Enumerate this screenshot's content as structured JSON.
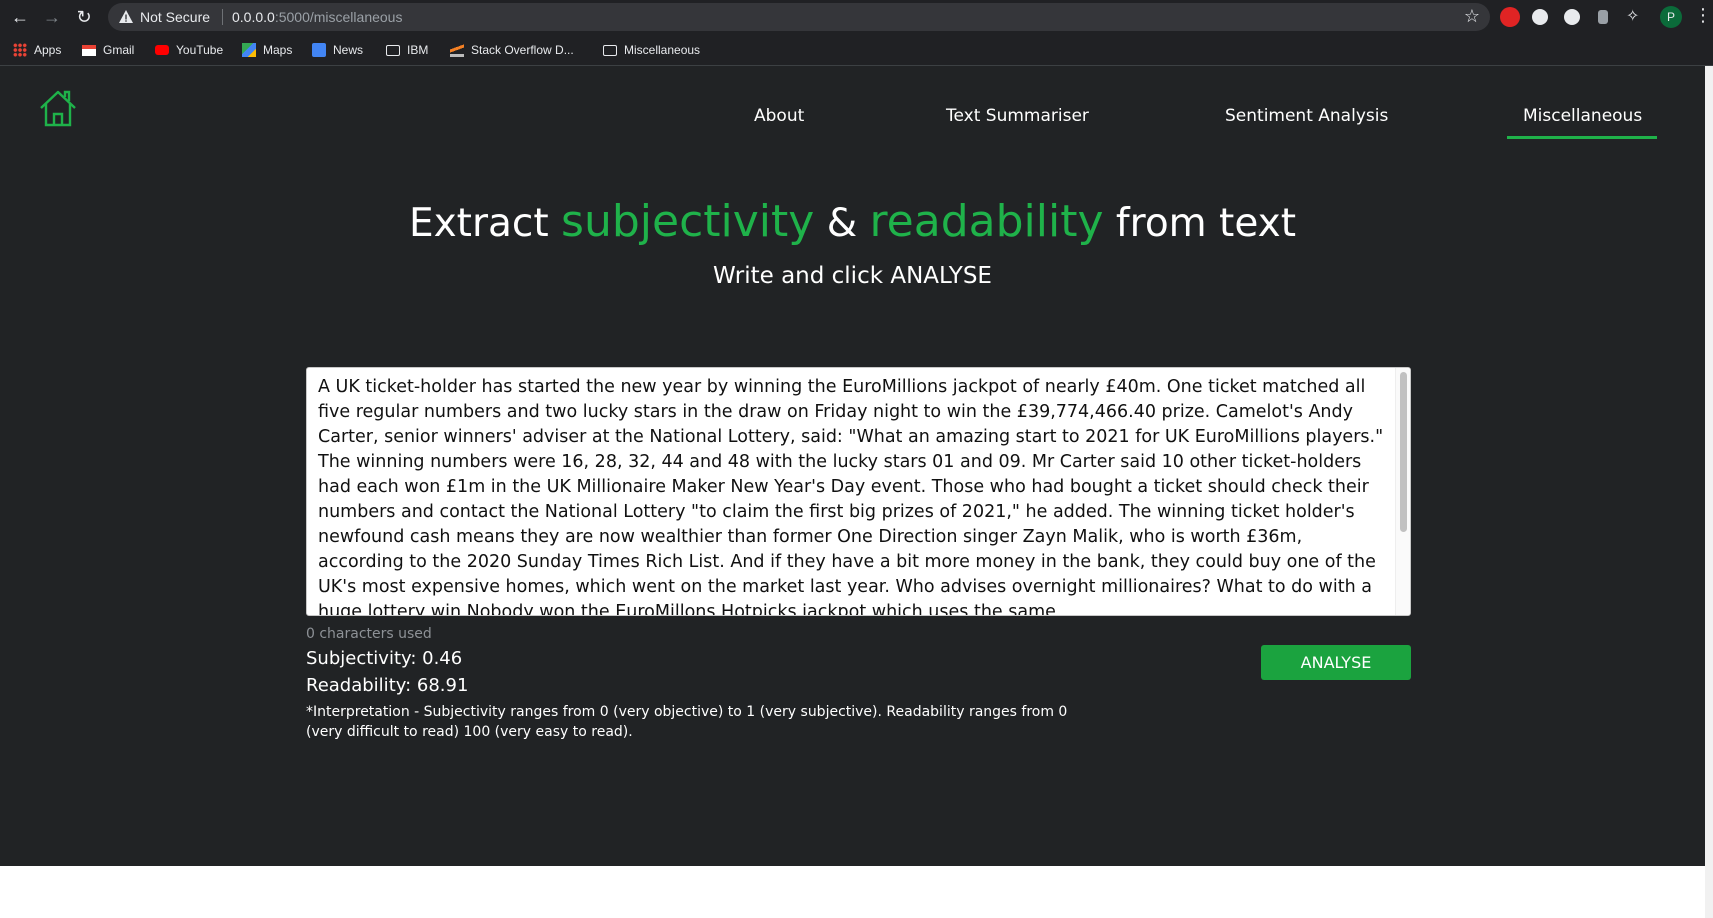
{
  "browser": {
    "security_label": "Not Secure",
    "url_host": "0.0.0.0",
    "url_rest": ":5000/miscellaneous",
    "profile_initial": "P",
    "bookmarks": [
      {
        "label": "Apps",
        "icon": "apps-grid-icon"
      },
      {
        "label": "Gmail",
        "icon": "gmail-icon"
      },
      {
        "label": "YouTube",
        "icon": "youtube-icon"
      },
      {
        "label": "Maps",
        "icon": "maps-icon"
      },
      {
        "label": "News",
        "icon": "news-icon"
      },
      {
        "label": "IBM",
        "icon": "folder-icon"
      },
      {
        "label": "Stack Overflow D...",
        "icon": "stackoverflow-icon"
      },
      {
        "label": "Miscellaneous",
        "icon": "folder-icon"
      }
    ]
  },
  "nav": {
    "links": [
      {
        "label": "About"
      },
      {
        "label": "Text Summariser"
      },
      {
        "label": "Sentiment Analysis"
      },
      {
        "label": "Miscellaneous",
        "active": true
      }
    ]
  },
  "hero": {
    "part1": "Extract",
    "word1": "subjectivity",
    "amp": "&",
    "word2": "readability",
    "part2": "from text",
    "subtitle": "Write and click ANALYSE"
  },
  "input": {
    "text": "A UK ticket-holder has started the new year by winning the EuroMillions jackpot of nearly £40m. One ticket matched all five regular numbers and two lucky stars in the draw on Friday night to win the £39,774,466.40 prize. Camelot's Andy Carter, senior winners' adviser at the National Lottery, said: \"What an amazing start to 2021 for UK EuroMillions players.\" The winning numbers were 16, 28, 32, 44 and 48 with the lucky stars 01 and 09. Mr Carter said 10 other ticket-holders had each won £1m in the UK Millionaire Maker New Year's Day event. Those who had bought a ticket should check their numbers and contact the National Lottery \"to claim the first big prizes of 2021,\" he added. The winning ticket holder's newfound cash means they are now wealthier than former One Direction singer Zayn Malik, who is worth £36m, according to the 2020 Sunday Times Rich List. And if they have a bit more money in the bank, they could buy one of the UK's most expensive homes, which went on the market last year. Who advises overnight millionaires? What to do with a huge lottery win Nobody won the EuroMillons Hotpicks jackpot which uses the same",
    "char_count": "0 characters used",
    "button": "ANALYSE"
  },
  "results": {
    "subjectivity": "Subjectivity: 0.46",
    "readability": "Readability: 68.91",
    "interpretation": "*Interpretation - Subjectivity ranges from 0 (very objective) to 1 (very subjective). Readability ranges from 0 (very difficult to read) 100 (very easy to read)."
  },
  "colors": {
    "accent": "#1fb24a",
    "background": "#212325",
    "button": "#1ba33f"
  }
}
